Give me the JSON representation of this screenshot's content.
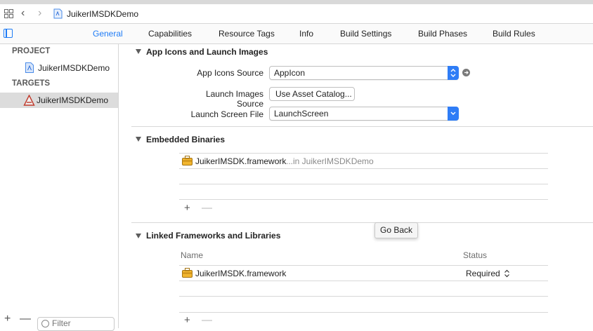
{
  "jumpbar": {
    "breadcrumb": "JuikerIMSDKDemo",
    "icons": [
      "grid-icon",
      "back-icon",
      "forward-icon",
      "project-file-icon"
    ]
  },
  "tabs": [
    {
      "label": "General",
      "active": true
    },
    {
      "label": "Capabilities",
      "active": false
    },
    {
      "label": "Resource Tags",
      "active": false
    },
    {
      "label": "Info",
      "active": false
    },
    {
      "label": "Build Settings",
      "active": false
    },
    {
      "label": "Build Phases",
      "active": false
    },
    {
      "label": "Build Rules",
      "active": false
    }
  ],
  "sidebar": {
    "project_header": "PROJECT",
    "project_item": "JuikerIMSDKDemo",
    "targets_header": "TARGETS",
    "target_item": "JuikerIMSDKDemo",
    "filter_placeholder": "Filter",
    "add_symbol": "+",
    "remove_symbol": "—"
  },
  "app_icons": {
    "title": "App Icons and Launch Images",
    "icons_source_label": "App Icons Source",
    "icons_source_value": "AppIcon",
    "launch_images_label": "Launch Images Source",
    "launch_images_button": "Use Asset Catalog...",
    "launch_screen_label": "Launch Screen File",
    "launch_screen_value": "LaunchScreen"
  },
  "embedded": {
    "title": "Embedded Binaries",
    "rows": [
      {
        "name": "JuikerIMSDK.framework",
        "location": "...in JuikerIMSDKDemo"
      }
    ],
    "add_symbol": "+",
    "remove_symbol": "—"
  },
  "linked": {
    "title": "Linked Frameworks and Libraries",
    "col_name": "Name",
    "col_status": "Status",
    "rows": [
      {
        "name": "JuikerIMSDK.framework",
        "status": "Required"
      }
    ],
    "add_symbol": "+",
    "remove_symbol": "—"
  },
  "tooltip": "Go Back",
  "colors": {
    "accent": "#1f7cf6",
    "selection": "#dcdcdc"
  }
}
